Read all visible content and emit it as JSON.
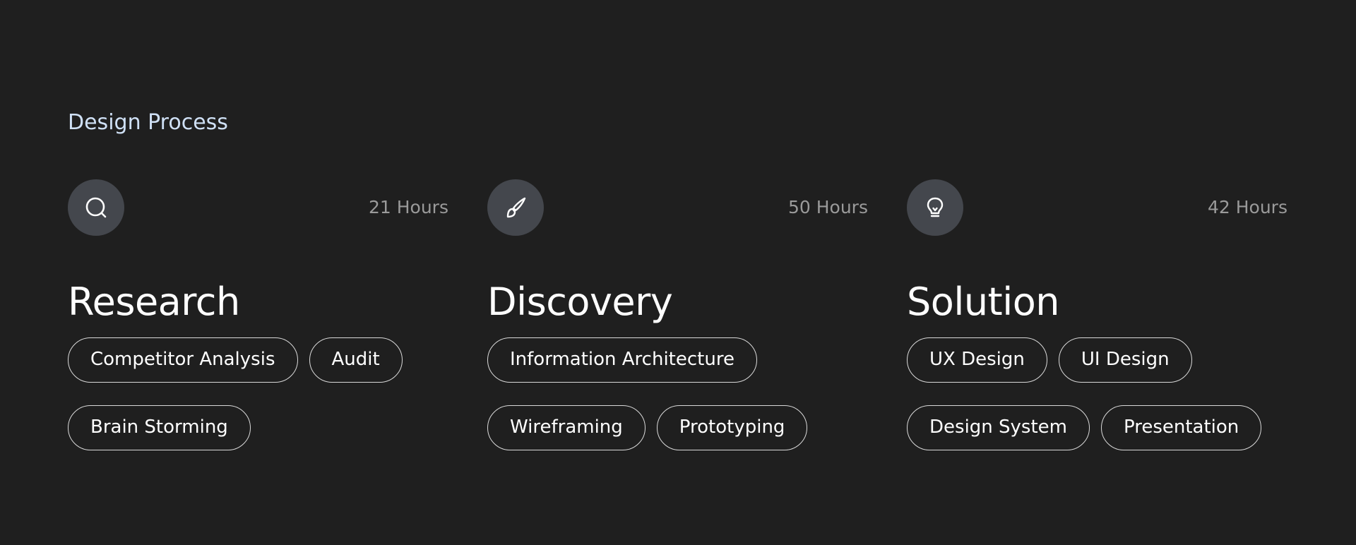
{
  "section_title": "Design Process",
  "columns": [
    {
      "icon": "search-icon",
      "hours": "21 Hours",
      "title": "Research",
      "tags": [
        "Competitor Analysis",
        "Audit",
        "Brain Storming"
      ]
    },
    {
      "icon": "brush-icon",
      "hours": "50 Hours",
      "title": "Discovery",
      "tags": [
        "Information Architecture",
        "Wireframing",
        "Prototyping"
      ]
    },
    {
      "icon": "lightbulb-icon",
      "hours": "42 Hours",
      "title": "Solution",
      "tags": [
        "UX Design",
        "UI Design",
        "Design System",
        "Presentation"
      ]
    }
  ],
  "colors": {
    "background": "#1f1f1f",
    "section_title": "#cfe0f5",
    "icon_circle": "#44474d",
    "hours_text": "#9a9a9a",
    "tag_border": "#d9d9d9",
    "text": "#ffffff"
  }
}
